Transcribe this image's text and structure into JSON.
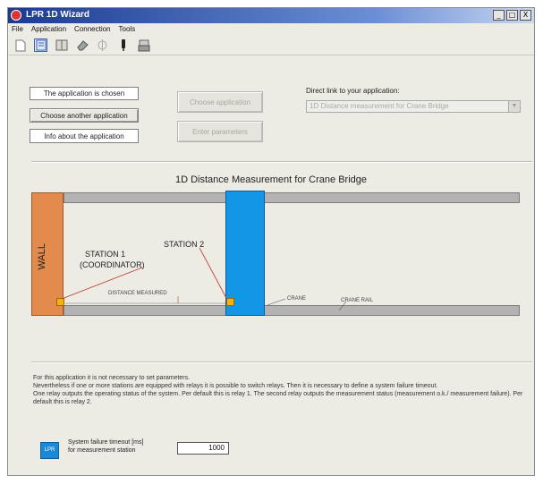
{
  "window": {
    "title": "LPR 1D Wizard",
    "controls": [
      "_",
      "□",
      "X"
    ]
  },
  "menu": [
    "File",
    "Application",
    "Connection",
    "Tools"
  ],
  "toolbar": {
    "icons": [
      "new-file-icon",
      "open-file-icon",
      "book-icon",
      "eraser-icon",
      "connect-icon",
      "device-icon",
      "printer-icon"
    ]
  },
  "buttons": {
    "app_chosen": "The application is chosen",
    "choose_another": "Choose another application",
    "info": "Info about the application",
    "disabled_1": "Choose application",
    "disabled_2": "Enter parameters"
  },
  "direct_link": {
    "label": "Direct link to your application:",
    "select_value": "1D Distance measurement for Crane Bridge"
  },
  "diagram": {
    "title": "1D Distance Measurement for Crane Bridge",
    "wall": "WALL",
    "station1": "STATION 1",
    "station1_sub": "(COORDINATOR)",
    "station2": "STATION 2",
    "distance": "DISTANCE MEASURED",
    "crane": "CRANE",
    "crane_rail": "CRANE RAIL"
  },
  "info_text": [
    "For this application it is not necessary to set parameters.",
    "Nevertheless if one or more stations are equipped with relays it is possible to switch relays. Then it is necessary to define a system failure timeout.",
    "One relay outputs the operating status of the system. Per default this is relay 1. The second relay outputs the measurement status (measurement o.k./ measurement failure). Per default this is relay 2."
  ],
  "timeout": {
    "label_line1": "System failure timeout [ms]",
    "label_line2": "for measurement station",
    "value": "1000",
    "icon_text": "LPR"
  }
}
